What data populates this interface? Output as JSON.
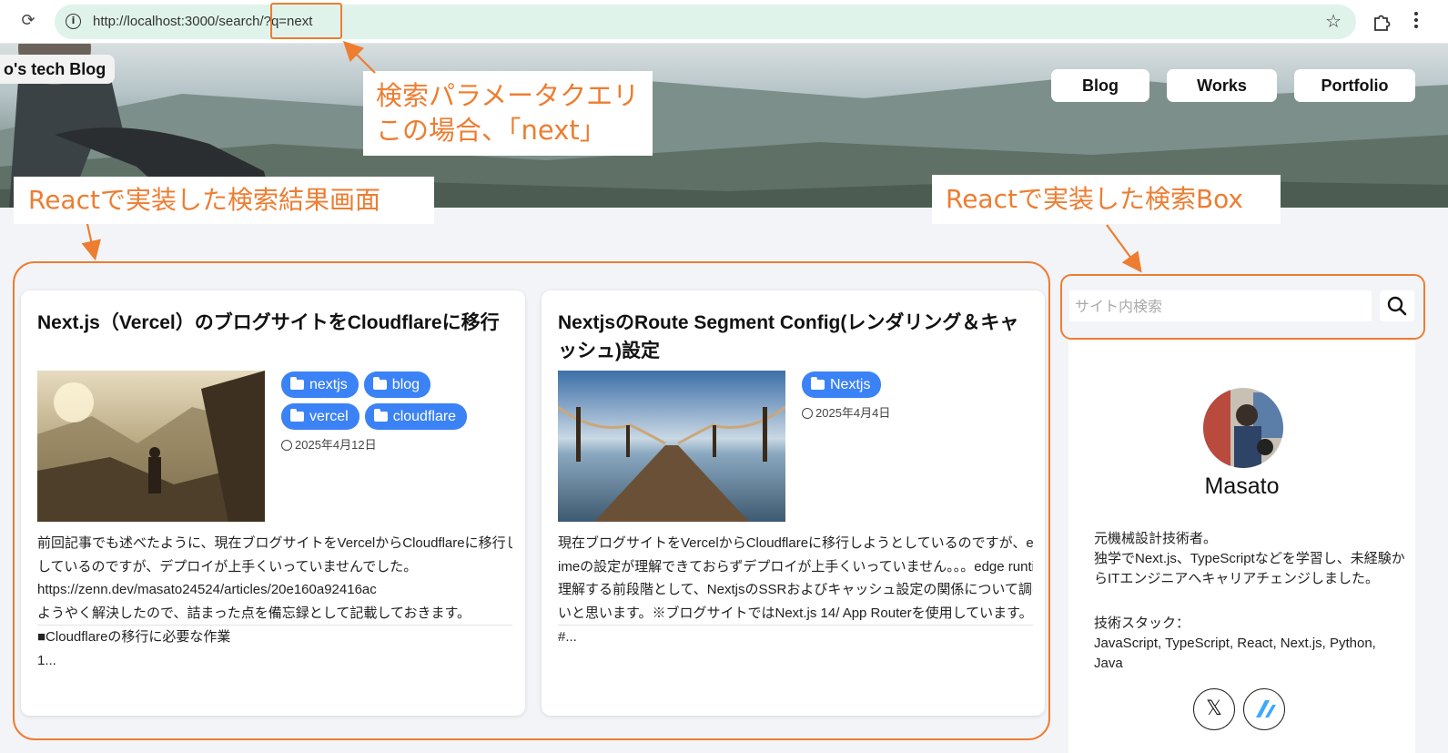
{
  "browser": {
    "url": "http://localhost:3000/search/?q=next",
    "reload_icon": "reload-icon",
    "info_icon": "i"
  },
  "site": {
    "title": "o's tech Blog",
    "nav": [
      "Blog",
      "Works",
      "Portfolio"
    ]
  },
  "results": [
    {
      "title": "Next.js（Vercel）のブログサイトをCloudflareに移行",
      "tags": [
        "nextjs",
        "blog",
        "vercel",
        "cloudflare"
      ],
      "date": "2025年4月12日",
      "excerpt_lines": [
        "前回記事でも述べたように、現在ブログサイトをVercelからCloudflareに移行しようと",
        "しているのですが、デプロイが上手くいっていませんでした。",
        "https://zenn.dev/masato24524/articles/20e160a92416ac",
        "ようやく解決したので、詰まった点を備忘録として記載しておきます。",
        "■Cloudflareの移行に必要な作業",
        "1..."
      ]
    },
    {
      "title": "NextjsのRoute Segment Config(レンダリング＆キャッシュ)設定",
      "tags": [
        "Nextjs"
      ],
      "date": "2025年4月4日",
      "excerpt_lines": [
        "現在ブログサイトをVercelからCloudflareに移行しようとしているのですが、edge runt",
        "imeの設定が理解できておらずデプロイが上手くいっていません。。。edge runtimeを",
        "理解する前段階として、NextjsのSSRおよびキャッシュ設定の関係について調べてみた",
        "いと思います。※ブログサイトではNext.js 14/ App Routerを使用しています。",
        "#..."
      ]
    }
  ],
  "sidebar": {
    "search_placeholder": "サイト内検索",
    "profile_name": "Masato",
    "bio_lines": [
      "元機械設計技術者。",
      "独学でNext.js、TypeScriptなどを学習し、未経験か",
      "らITエンジニアへキャリアチェンジしました。"
    ],
    "stack_label": "技術スタック：",
    "stack_lines": [
      "JavaScript, TypeScript, React, Next.js, Python,",
      "Java"
    ],
    "social": [
      "𝕏",
      "zenn-icon"
    ]
  },
  "annotations": {
    "query_param": [
      "検索パラメータクエリ",
      "この場合、「next」"
    ],
    "results_label": "Reactで実装した検索結果画面",
    "searchbox_label": "Reactで実装した検索Box"
  },
  "colors": {
    "annotation": "#ed7d31",
    "tag": "#3b82f6",
    "url_bar": "#dff3ea"
  }
}
